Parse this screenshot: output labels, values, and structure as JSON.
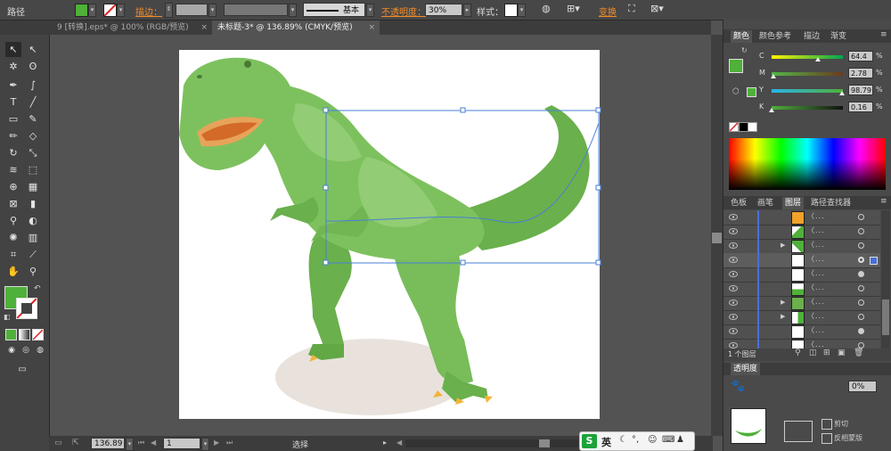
{
  "control_bar": {
    "object_type": "路径",
    "stroke_label": "描边：",
    "brush_label": "基本",
    "opacity_label": "不透明度：",
    "opacity_value": "30%",
    "style_label": "样式：",
    "transform_link": "变换",
    "fill_color": "#4fb03a"
  },
  "tabs": [
    {
      "label": "9 [转换].eps* @ 100% (RGB/预览)"
    },
    {
      "label": "未标题-3* @ 136.89% (CMYK/预览)"
    }
  ],
  "status": {
    "zoom": "136.89",
    "page": "1",
    "tool": "选择"
  },
  "color_panel": {
    "tabs": [
      "颜色",
      "颜色参考",
      "描边",
      "渐变"
    ],
    "channels": [
      {
        "label": "C",
        "value": "64.4",
        "unit": "%",
        "fraction": 0.644
      },
      {
        "label": "M",
        "value": "2.78",
        "unit": "%",
        "fraction": 0.028
      },
      {
        "label": "Y",
        "value": "98.79",
        "unit": "%",
        "fraction": 0.988
      },
      {
        "label": "K",
        "value": "0.16",
        "unit": "%",
        "fraction": 0.002
      }
    ]
  },
  "layers_panel": {
    "tabs": [
      "色板",
      "画笔",
      "图层",
      "路径查找器"
    ],
    "rows": [
      "〈...",
      "〈...",
      "〈...",
      "〈...",
      "〈...",
      "〈...",
      "〈...",
      "〈...",
      "〈...",
      "〈..."
    ],
    "count": "1 个图层"
  },
  "transparency_panel": {
    "tab": "透明度",
    "value": "0%",
    "clip_label": "剪切",
    "invert_label": "反相蒙版"
  },
  "ime_toolbar": {
    "lang": "英"
  }
}
